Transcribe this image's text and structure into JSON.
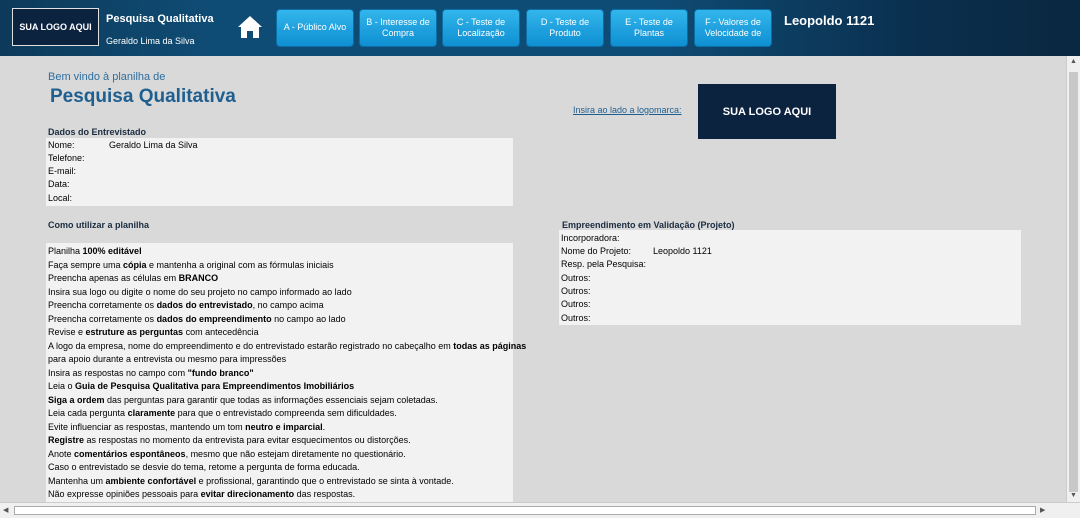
{
  "header": {
    "logo": "SUA LOGO AQUI",
    "title": "Pesquisa Qualitativa",
    "subtitle": "Geraldo Lima da Silva",
    "nav": [
      "A - Público Alvo",
      "B - Interesse de Compra",
      "C - Teste de Localização",
      "D - Teste de Produto",
      "E - Teste de Plantas",
      "F - Valores de Velocidade de"
    ],
    "project": "Leopoldo 1121"
  },
  "main": {
    "welcome": "Bem vindo à planilha de",
    "title": "Pesquisa Qualitativa",
    "logo_link": "Insira ao lado a logomarca:",
    "logo": "SUA LOGO AQUI"
  },
  "interviewee": {
    "title": "Dados do Entrevistado",
    "fields": [
      {
        "label": "Nome:",
        "value": "Geraldo Lima da Silva"
      },
      {
        "label": "Telefone:",
        "value": ""
      },
      {
        "label": "E-mail:",
        "value": ""
      },
      {
        "label": "Data:",
        "value": ""
      },
      {
        "label": "Local:",
        "value": ""
      }
    ]
  },
  "howto": {
    "title": "Como utilizar a planilha",
    "lines": [
      [
        {
          "t": "Planilha "
        },
        {
          "t": "100% editável",
          "b": true
        }
      ],
      [
        {
          "t": "Faça sempre uma "
        },
        {
          "t": "cópia",
          "b": true
        },
        {
          "t": " e mantenha a original com as fórmulas iniciais"
        }
      ],
      [
        {
          "t": "Preencha apenas as células em "
        },
        {
          "t": "BRANCO",
          "b": true
        }
      ],
      [
        {
          "t": "Insira sua logo ou digite o nome do seu projeto no campo informado ao lado"
        }
      ],
      [
        {
          "t": "Preencha corretamente os "
        },
        {
          "t": "dados do entrevistado",
          "b": true
        },
        {
          "t": ", no campo acima"
        }
      ],
      [
        {
          "t": "Preencha corretamente os "
        },
        {
          "t": "dados do empreendimento",
          "b": true
        },
        {
          "t": " no campo ao lado"
        }
      ],
      [
        {
          "t": "Revise e "
        },
        {
          "t": "estruture as perguntas",
          "b": true
        },
        {
          "t": " com antecedência"
        }
      ],
      [
        {
          "t": "A logo da empresa, nome do empreendimento e do entrevistado estarão registrado no cabeçalho em "
        },
        {
          "t": "todas as páginas",
          "b": true
        }
      ],
      [
        {
          "t": "para apoio durante a entrevista ou mesmo para impressões"
        }
      ],
      [
        {
          "t": "Insira as respostas no campo com "
        },
        {
          "t": "\"fundo branco\"",
          "b": true
        }
      ],
      [
        {
          "t": "Leia o "
        },
        {
          "t": "Guia de Pesquisa Qualitativa para Empreendimentos Imobiliários",
          "b": true
        }
      ],
      [
        {
          "t": "Siga a ordem",
          "b": true
        },
        {
          "t": " das perguntas para garantir que todas as informações essenciais sejam coletadas."
        }
      ],
      [
        {
          "t": "Leia cada pergunta "
        },
        {
          "t": "claramente",
          "b": true
        },
        {
          "t": " para que o entrevistado compreenda sem dificuldades."
        }
      ],
      [
        {
          "t": "Evite influenciar as respostas, mantendo um tom "
        },
        {
          "t": "neutro e imparcial",
          "b": true
        },
        {
          "t": "."
        }
      ],
      [
        {
          "t": "Registre",
          "b": true
        },
        {
          "t": " as respostas no momento da entrevista para evitar esquecimentos ou distorções."
        }
      ],
      [
        {
          "t": "Anote "
        },
        {
          "t": "comentários espontâneos",
          "b": true
        },
        {
          "t": ", mesmo que não estejam diretamente no questionário."
        }
      ],
      [
        {
          "t": "Caso o entrevistado se desvie do tema, retome a pergunta de forma educada."
        }
      ],
      [
        {
          "t": "Mantenha um "
        },
        {
          "t": "ambiente confortável",
          "b": true
        },
        {
          "t": " e profissional, garantindo que o entrevistado se sinta à vontade."
        }
      ],
      [
        {
          "t": "Não expresse opiniões pessoais para "
        },
        {
          "t": "evitar direcionamento",
          "b": true
        },
        {
          "t": " das respostas."
        }
      ]
    ]
  },
  "project": {
    "title": "Empreendimento em Validação (Projeto)",
    "fields": [
      {
        "label": "Incorporadora:",
        "value": ""
      },
      {
        "label": "Nome do Projeto:",
        "value": "Leopoldo 1121"
      },
      {
        "label": "Resp. pela Pesquisa:",
        "value": ""
      },
      {
        "label": "Outros:",
        "value": ""
      },
      {
        "label": "Outros:",
        "value": ""
      },
      {
        "label": "Outros:",
        "value": ""
      },
      {
        "label": "Outros:",
        "value": ""
      }
    ]
  },
  "colors": {
    "header_dark": "#0c2340",
    "nav_button": "#1aa3e0",
    "title_blue": "#1f5f8f"
  },
  "icons": [
    "home-icon"
  ]
}
